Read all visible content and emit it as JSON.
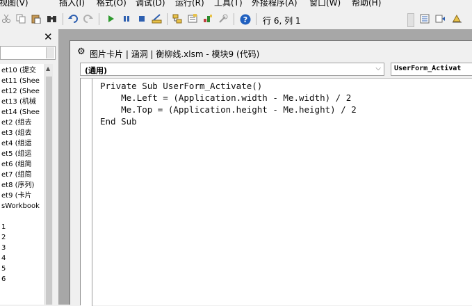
{
  "menubar": {
    "items": [
      "视图(V)",
      "插入(I)",
      "格式(O)",
      "调试(D)",
      "运行(R)",
      "工具(T)",
      "外接程序(A)",
      "窗口(W)",
      "帮助(H)"
    ]
  },
  "toolbar": {
    "cursor_position": "行 6, 列 1",
    "icons": [
      "cut-icon",
      "copy-icon",
      "paste-icon",
      "find-icon",
      "undo-icon",
      "redo-icon",
      "run-icon",
      "break-icon",
      "reset-icon",
      "design-mode-icon",
      "project-explorer-icon",
      "properties-icon",
      "object-browser-icon",
      "toolbox-icon",
      "help-icon"
    ]
  },
  "project_panel": {
    "items": [
      "et10 (提交",
      "et11 (Shee",
      "et12 (Shee",
      "et13 (机械",
      "et14 (Shee",
      "et2 (组去",
      "et3 (组去",
      "et4 (组运",
      "et5 (组运",
      "et6 (组简",
      "et7 (组简",
      "et8 (序列)",
      "et9 (卡片",
      "sWorkbook",
      "",
      "1",
      "2",
      "3",
      "4",
      "5",
      "6"
    ]
  },
  "code_window": {
    "title": "图片卡片 | 涵洞 | 衡柳线.xlsm - 模块9 (代码)",
    "object_combo": "(通用)",
    "procedure_combo": "UserForm_Activat",
    "code_lines": [
      "Private Sub UserForm_Activate()",
      "    Me.Left = (Application.width - Me.width) / 2",
      "    Me.Top = (Application.height - Me.height) / 2",
      "End Sub"
    ]
  },
  "colors": {
    "mdi_background": "#a7a7a7",
    "window_chrome": "#f0f0f0",
    "code_background": "#ffffff",
    "run_green": "#2e9a2e",
    "help_blue": "#1f5fbf"
  }
}
